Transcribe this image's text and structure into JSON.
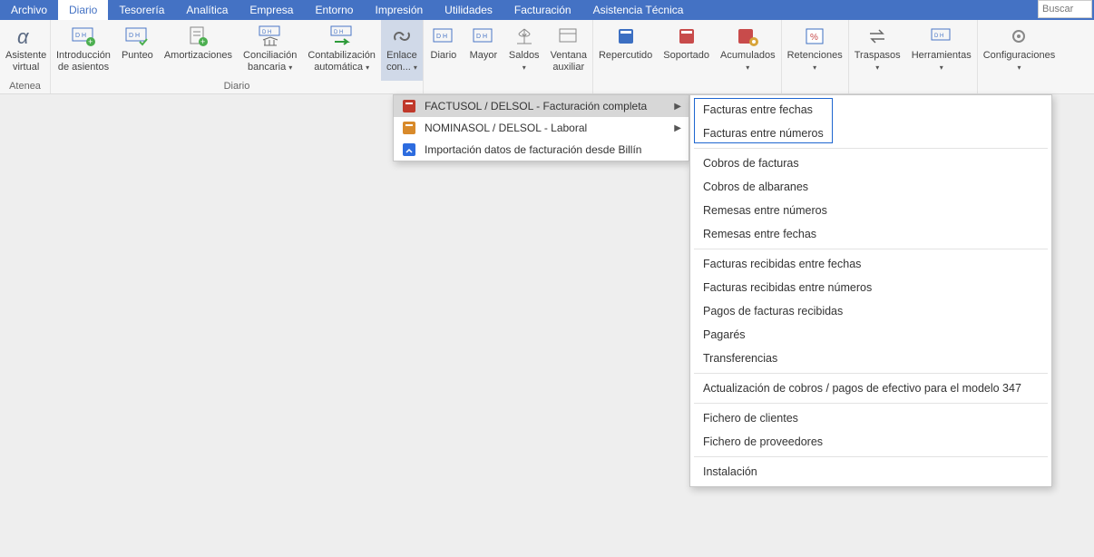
{
  "search_placeholder": "Buscar",
  "subtitle": "Atenea",
  "tabs": [
    {
      "label": "Archivo"
    },
    {
      "label": "Diario"
    },
    {
      "label": "Tesorería"
    },
    {
      "label": "Analítica"
    },
    {
      "label": "Empresa"
    },
    {
      "label": "Entorno"
    },
    {
      "label": "Impresión"
    },
    {
      "label": "Utilidades"
    },
    {
      "label": "Facturación"
    },
    {
      "label": "Asistencia Técnica"
    }
  ],
  "ribbon": {
    "g1_label": "",
    "g2_label": "Diario",
    "btn_asistente1": "Asistente",
    "btn_asistente2": "virtual",
    "btn_introduccion1": "Introducción",
    "btn_introduccion2": "de asientos",
    "btn_punteo": "Punteo",
    "btn_amort": "Amortizaciones",
    "btn_conc1": "Conciliación",
    "btn_conc2": "bancaria",
    "btn_contab1": "Contabilización",
    "btn_contab2": "automática",
    "btn_enlace1": "Enlace",
    "btn_enlace2": "con...",
    "btn_diario": "Diario",
    "btn_mayor": "Mayor",
    "btn_saldos": "Saldos",
    "btn_ventana1": "Ventana",
    "btn_ventana2": "auxiliar",
    "btn_reperc": "Repercutido",
    "btn_sopor": "Soportado",
    "btn_acum": "Acumulados",
    "btn_reten": "Retenciones",
    "btn_trasp": "Traspasos",
    "btn_herr": "Herramientas",
    "btn_conf": "Configuraciones"
  },
  "menu1": {
    "items": [
      {
        "label": "FACTUSOL / DELSOL - Facturación completa",
        "arrow": true,
        "hover": true,
        "icon": "red"
      },
      {
        "label": "NOMINASOL / DELSOL - Laboral",
        "arrow": true,
        "icon": "orange"
      },
      {
        "label": "Importación datos de facturación desde Billín",
        "arrow": false,
        "icon": "blue"
      }
    ]
  },
  "menu2": {
    "groups": [
      [
        "Facturas entre fechas",
        "Facturas entre números"
      ],
      [
        "Cobros de facturas",
        "Cobros de albaranes",
        "Remesas entre números",
        "Remesas entre fechas"
      ],
      [
        "Facturas recibidas entre fechas",
        "Facturas recibidas entre números",
        "Pagos de facturas recibidas",
        "Pagarés",
        "Transferencias"
      ],
      [
        "Actualización de cobros / pagos de efectivo para el modelo 347"
      ],
      [
        "Fichero de clientes",
        "Fichero de proveedores"
      ],
      [
        "Instalación"
      ]
    ]
  }
}
